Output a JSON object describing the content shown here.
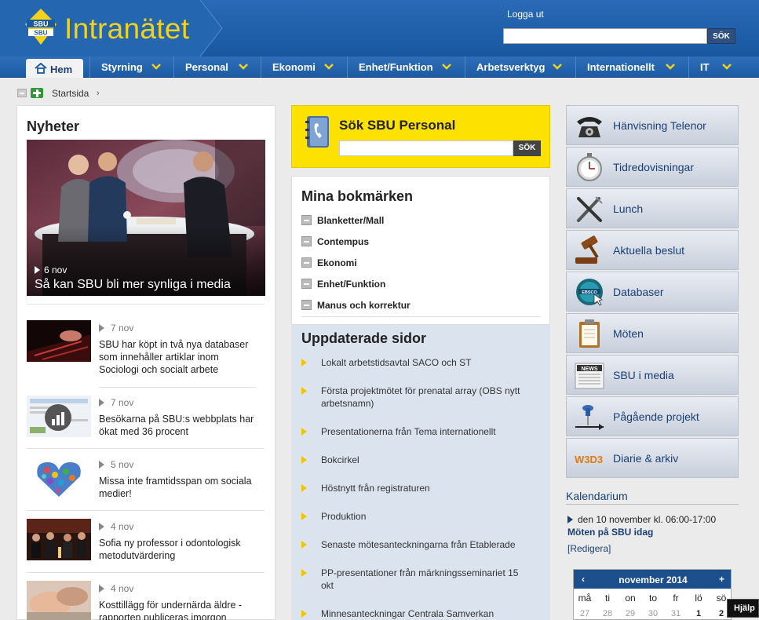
{
  "header": {
    "logo_text": "SBU",
    "brand": "Intranätet",
    "logout": "Logga ut",
    "search_button": "SÖK"
  },
  "nav": {
    "home": "Hem",
    "items": [
      {
        "label": "Styrning"
      },
      {
        "label": "Personal"
      },
      {
        "label": "Ekonomi"
      },
      {
        "label": "Enhet/Funktion"
      },
      {
        "label": "Arbetsverktyg"
      },
      {
        "label": "Internationellt"
      },
      {
        "label": "IT"
      }
    ]
  },
  "breadcrumb": {
    "current": "Startsida"
  },
  "news": {
    "title": "Nyheter",
    "hero": {
      "date": "6 nov",
      "caption": "Så kan SBU bli mer synliga i media"
    },
    "items": [
      {
        "date": "7 nov",
        "text": "SBU har köpt in två nya databaser som innehåller artiklar inom Sociologi och socialt arbete"
      },
      {
        "date": "7 nov",
        "text": "Besökarna på SBU:s webbplats har ökat med 36 procent"
      },
      {
        "date": "5 nov",
        "text": "Missa inte framtidsspan om sociala medier!"
      },
      {
        "date": "4 nov",
        "text": "Sofia ny professor i odontologisk metodutvärdering"
      },
      {
        "date": "4 nov",
        "text": "Kosttillägg för undernärda äldre - rapporten publiceras imorgon"
      }
    ]
  },
  "personal_search": {
    "title": "Sök SBU Personal",
    "button": "SÖK"
  },
  "bookmarks": {
    "title": "Mina bokmärken",
    "items": [
      {
        "label": "Blanketter/Mall"
      },
      {
        "label": "Contempus"
      },
      {
        "label": "Ekonomi"
      },
      {
        "label": "Enhet/Funktion"
      },
      {
        "label": "Manus och korrektur"
      }
    ]
  },
  "updated": {
    "title": "Uppdaterade sidor",
    "items": [
      {
        "label": "Lokalt arbetstidsavtal SACO och ST"
      },
      {
        "label": "Första projektmötet för prenatal array (OBS nytt arbetsnamn)"
      },
      {
        "label": "Presentationerna från Tema internationellt"
      },
      {
        "label": "Bokcirkel"
      },
      {
        "label": "Höstnytt från registraturen"
      },
      {
        "label": "Produktion"
      },
      {
        "label": "Senaste mötesanteckningarna från Etablerade"
      },
      {
        "label": "PP-presentationer från märkningsseminariet 15 okt"
      },
      {
        "label": "Minnesanteckningar Centrala Samverkan"
      }
    ]
  },
  "quicklinks": [
    {
      "label": "Hänvisning Telenor",
      "icon": "telephone-icon"
    },
    {
      "label": "Tidredovisningar",
      "icon": "stopwatch-icon"
    },
    {
      "label": "Lunch",
      "icon": "cutlery-icon"
    },
    {
      "label": "Aktuella beslut",
      "icon": "gavel-icon"
    },
    {
      "label": "Databaser",
      "icon": "ebsco-database-icon"
    },
    {
      "label": "Möten",
      "icon": "clipboard-icon"
    },
    {
      "label": "SBU i media",
      "icon": "newspaper-icon"
    },
    {
      "label": "Pågående projekt",
      "icon": "pushpin-icon"
    },
    {
      "label": "Diarie & arkiv",
      "icon": "w3d3-logo-icon",
      "icon_text": "W3D3"
    }
  ],
  "calendar": {
    "title": "Kalendarium",
    "event_date": "den 10 november kl. 06:00-17:00",
    "event_title": "Möten på SBU idag",
    "edit": "[Redigera]",
    "month": "november 2014",
    "prev": "‹",
    "next": "+",
    "dow": [
      "må",
      "ti",
      "on",
      "to",
      "fr",
      "lö",
      "sö"
    ],
    "days": [
      {
        "d": "27",
        "cur": false
      },
      {
        "d": "28",
        "cur": false
      },
      {
        "d": "29",
        "cur": false
      },
      {
        "d": "30",
        "cur": false
      },
      {
        "d": "31",
        "cur": false
      },
      {
        "d": "1",
        "cur": true
      },
      {
        "d": "2",
        "cur": true
      }
    ]
  },
  "help": {
    "label": "Hjälp"
  },
  "colors": {
    "header_blue": "#1a5aa3",
    "brand_yellow": "#f2d21a",
    "sok_yellow": "#fde100",
    "link_blue": "#1a3f73"
  }
}
